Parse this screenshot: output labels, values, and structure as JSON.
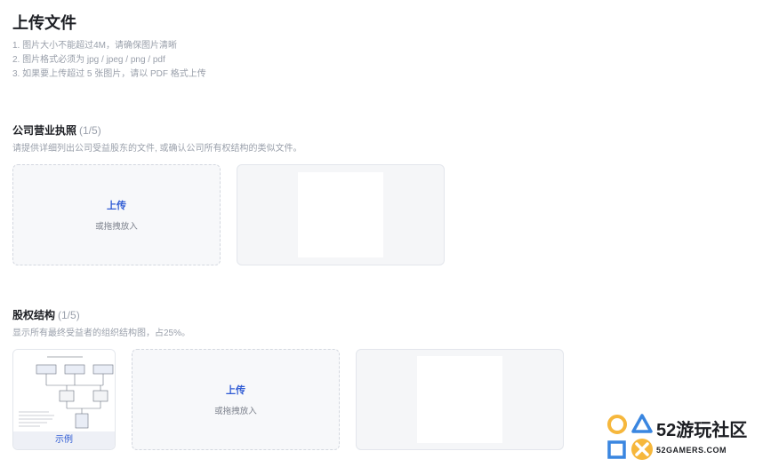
{
  "page": {
    "title": "上传文件",
    "rules": [
      "1. 图片大小不能超过4M，请确保图片清晰",
      "2. 图片格式必须为 jpg / jpeg / png / pdf",
      "3. 如果要上传超过 5 张图片，请以 PDF 格式上传"
    ]
  },
  "business_license": {
    "title": "公司营业执照",
    "count": "(1/5)",
    "description": "请提供详细列出公司受益股东的文件, 或确认公司所有权结构的类似文件。",
    "upload_label": "上传",
    "drag_hint": "或拖拽放入"
  },
  "ownership_structure": {
    "title": "股权结构",
    "count": "(1/5)",
    "description": "显示所有最终受益者的组织结构图，占25%。",
    "example_label": "示例",
    "upload_label": "上传",
    "drag_hint": "或拖拽放入"
  },
  "watermark": {
    "text": "52游玩社区",
    "subtext": "52GAMERS.COM"
  }
}
